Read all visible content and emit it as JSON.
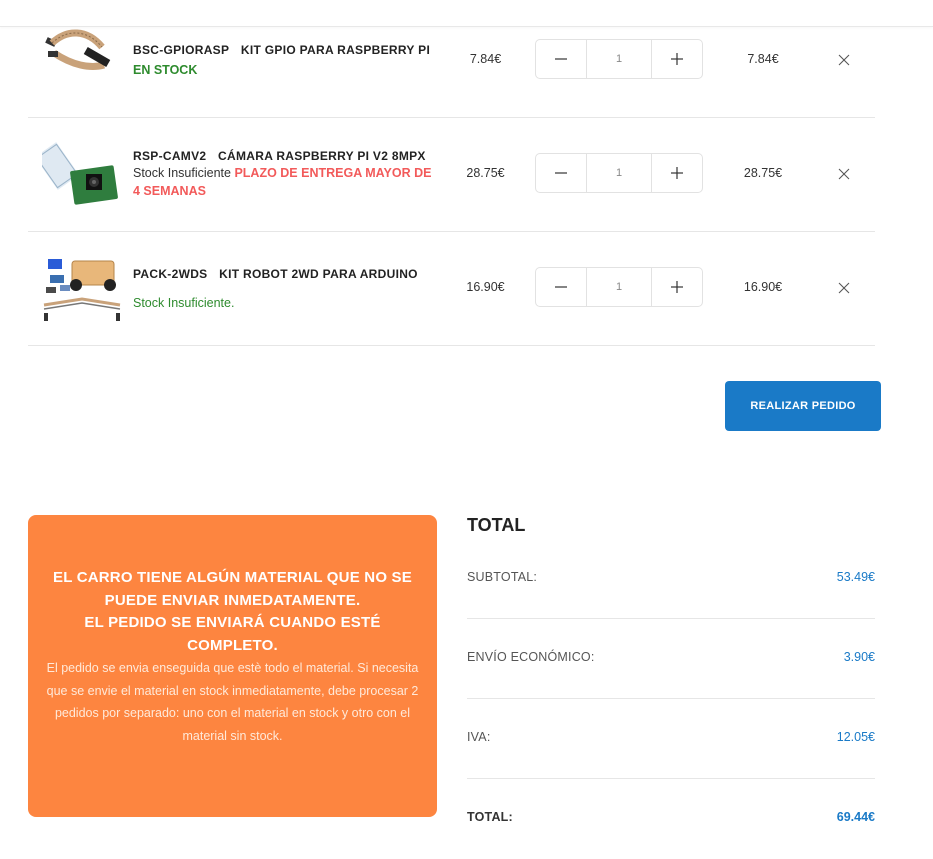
{
  "cart": {
    "items": [
      {
        "sku": "BSC-GPIORASP",
        "name": "KIT GPIO PARA RASPBERRY PI",
        "stock_status": "EN STOCK",
        "unit_price": "7.84€",
        "quantity": "1",
        "line_total": "7.84€"
      },
      {
        "sku": "RSP-CAMV2",
        "name": "CÁMARA RASPBERRY PI V2 8MPX",
        "stock_status": "Stock Insuficiente",
        "stock_warning": "PLAZO DE ENTREGA MAYOR DE 4 SEMANAS",
        "unit_price": "28.75€",
        "quantity": "1",
        "line_total": "28.75€"
      },
      {
        "sku": "PACK-2WDS",
        "name": "KIT ROBOT 2WD PARA ARDUINO",
        "stock_status": "Stock Insuficiente.",
        "unit_price": "16.90€",
        "quantity": "1",
        "line_total": "16.90€"
      }
    ],
    "order_button_label": "REALIZAR PEDIDO"
  },
  "notice": {
    "headline_1": "EL CARRO TIENE ALGÚN MATERIAL QUE NO SE PUEDE ENVIAR INMEDATAMENTE.",
    "headline_2": "EL PEDIDO SE ENVIARÁ CUANDO ESTÉ COMPLETO.",
    "body": "El pedido se envia enseguida que estè todo el material. Si necesita que se envie el material en stock inmediatamente, debe procesar 2 pedidos por separado: uno con el material en stock y otro con el material sin stock."
  },
  "summary": {
    "title": "TOTAL",
    "rows": [
      {
        "label": "SUBTOTAL:",
        "value": "53.49€"
      },
      {
        "label": "ENVÍO ECONÓMICO:",
        "value": "3.90€"
      },
      {
        "label": "IVA:",
        "value": "12.05€"
      },
      {
        "label": "TOTAL:",
        "value": "69.44€"
      }
    ]
  },
  "colors": {
    "accent_blue": "#1a7ac7",
    "notice_orange": "#fd8540",
    "in_stock_green": "#2e8b2e",
    "warning_red": "#f25a5a"
  },
  "icons": {
    "decrease": "minus-icon",
    "increase": "plus-icon",
    "remove": "close-icon"
  }
}
